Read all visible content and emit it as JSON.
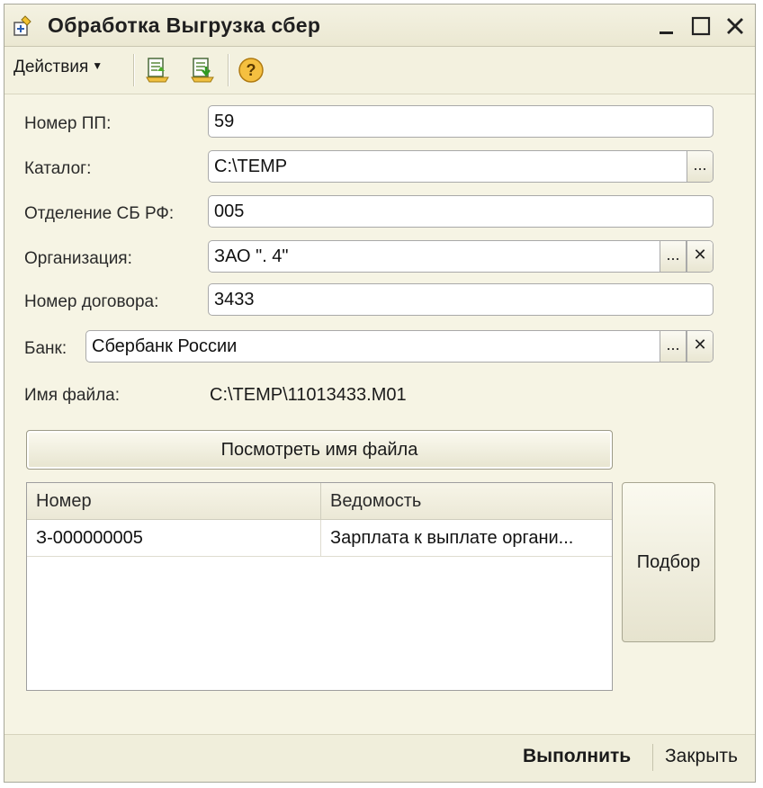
{
  "window": {
    "title": "Обработка  Выгрузка сбер",
    "minimize_label": "_",
    "maximize_label": "☐",
    "close_label": "✕"
  },
  "toolbar": {
    "actions_label": "Действия",
    "icons": [
      "upload-document-icon",
      "download-document-icon",
      "help-icon"
    ],
    "help_glyph": "?"
  },
  "form": {
    "payment_number": {
      "label": "Номер ПП:",
      "value": "59"
    },
    "catalog": {
      "label": "Каталог:",
      "value": "C:\\TEMP",
      "select_button": "..."
    },
    "sb_branch": {
      "label": "Отделение СБ РФ:",
      "value": "005"
    },
    "organization": {
      "label": "Организация:",
      "value": "ЗАО \".      4\"",
      "select_button": "...",
      "clear_button": "✕"
    },
    "contract_number": {
      "label": "Номер договора:",
      "value": "3433"
    },
    "bank": {
      "label": "Банк:",
      "value": "Сбербанк России",
      "select_button": "...",
      "clear_button": "✕"
    },
    "file_name": {
      "label": "Имя файла:",
      "value": "C:\\TEMP\\11013433.M01"
    }
  },
  "view_file_button": "Посмотреть имя файла",
  "table": {
    "columns": [
      "Номер",
      "Ведомость"
    ],
    "rows": [
      {
        "number": "З-000000005",
        "statement": "Зарплата к выплате органи..."
      }
    ]
  },
  "select_button": "Подбор",
  "footer": {
    "execute_label": "Выполнить",
    "close_label": "Закрыть"
  },
  "colors": {
    "window_bg": "#f6f4e4",
    "border": "#a9a9a9",
    "help_icon": "#f0b429"
  }
}
